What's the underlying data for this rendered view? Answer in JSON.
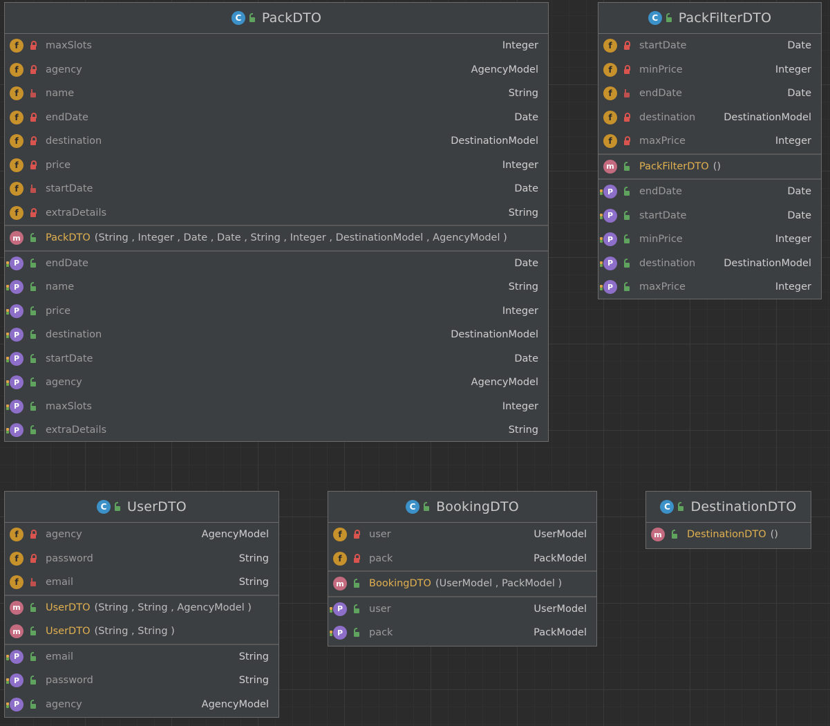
{
  "classes": {
    "pack": {
      "title": "PackDTO",
      "fields": [
        {
          "name": "maxSlots",
          "type": "Integer",
          "vis": "lock"
        },
        {
          "name": "agency",
          "type": "AgencyModel",
          "vis": "lock"
        },
        {
          "name": "name",
          "type": "String",
          "vis": "pkg"
        },
        {
          "name": "endDate",
          "type": "Date",
          "vis": "lock"
        },
        {
          "name": "destination",
          "type": "DestinationModel",
          "vis": "lock"
        },
        {
          "name": "price",
          "type": "Integer",
          "vis": "lock"
        },
        {
          "name": "startDate",
          "type": "Date",
          "vis": "pkg"
        },
        {
          "name": "extraDetails",
          "type": "String",
          "vis": "lock"
        }
      ],
      "constructors": [
        {
          "name": "PackDTO",
          "params": "(String , Integer , Date , Date , String , Integer , DestinationModel   , AgencyModel  )"
        }
      ],
      "properties": [
        {
          "name": "endDate",
          "type": "Date"
        },
        {
          "name": "name",
          "type": "String"
        },
        {
          "name": "price",
          "type": "Integer"
        },
        {
          "name": "destination",
          "type": "DestinationModel"
        },
        {
          "name": "startDate",
          "type": "Date"
        },
        {
          "name": "agency",
          "type": "AgencyModel"
        },
        {
          "name": "maxSlots",
          "type": "Integer"
        },
        {
          "name": "extraDetails",
          "type": "String"
        }
      ]
    },
    "packFilter": {
      "title": "PackFilterDTO",
      "fields": [
        {
          "name": "startDate",
          "type": "Date",
          "vis": "lock"
        },
        {
          "name": "minPrice",
          "type": "Integer",
          "vis": "lock"
        },
        {
          "name": "endDate",
          "type": "Date",
          "vis": "pkg"
        },
        {
          "name": "destination",
          "type": "DestinationModel",
          "vis": "lock"
        },
        {
          "name": "maxPrice",
          "type": "Integer",
          "vis": "lock"
        }
      ],
      "constructors": [
        {
          "name": "PackFilterDTO",
          "params": "()"
        }
      ],
      "properties": [
        {
          "name": "endDate",
          "type": "Date"
        },
        {
          "name": "startDate",
          "type": "Date"
        },
        {
          "name": "minPrice",
          "type": "Integer"
        },
        {
          "name": "destination",
          "type": "DestinationModel"
        },
        {
          "name": "maxPrice",
          "type": "Integer"
        }
      ]
    },
    "user": {
      "title": "UserDTO",
      "fields": [
        {
          "name": "agency",
          "type": "AgencyModel",
          "vis": "lock"
        },
        {
          "name": "password",
          "type": "String",
          "vis": "lock"
        },
        {
          "name": "email",
          "type": "String",
          "vis": "pkg"
        }
      ],
      "constructors": [
        {
          "name": "UserDTO",
          "params": "(String , String , AgencyModel  )"
        },
        {
          "name": "UserDTO",
          "params": "(String , String )"
        }
      ],
      "properties": [
        {
          "name": "email",
          "type": "String"
        },
        {
          "name": "password",
          "type": "String"
        },
        {
          "name": "agency",
          "type": "AgencyModel"
        }
      ]
    },
    "booking": {
      "title": "BookingDTO",
      "fields": [
        {
          "name": "user",
          "type": "UserModel",
          "vis": "lock"
        },
        {
          "name": "pack",
          "type": "PackModel",
          "vis": "lock"
        }
      ],
      "constructors": [
        {
          "name": "BookingDTO",
          "params": "(UserModel  , PackModel  )"
        }
      ],
      "properties": [
        {
          "name": "user",
          "type": "UserModel"
        },
        {
          "name": "pack",
          "type": "PackModel"
        }
      ]
    },
    "destination": {
      "title": "DestinationDTO",
      "fields": [],
      "constructors": [
        {
          "name": "DestinationDTO",
          "params": "()"
        }
      ],
      "properties": []
    }
  },
  "icons": {
    "class": "class-icon",
    "field": "field-icon",
    "method": "method-icon",
    "property": "property-icon"
  },
  "colors": {
    "background": "#2b2b2b",
    "node": "#3c3f41",
    "constructor_text": "#e0b050",
    "class_icon": "#3d91c9",
    "field_icon": "#c7912c",
    "method_icon": "#c46b80",
    "property_icon": "#8d6fc9"
  }
}
